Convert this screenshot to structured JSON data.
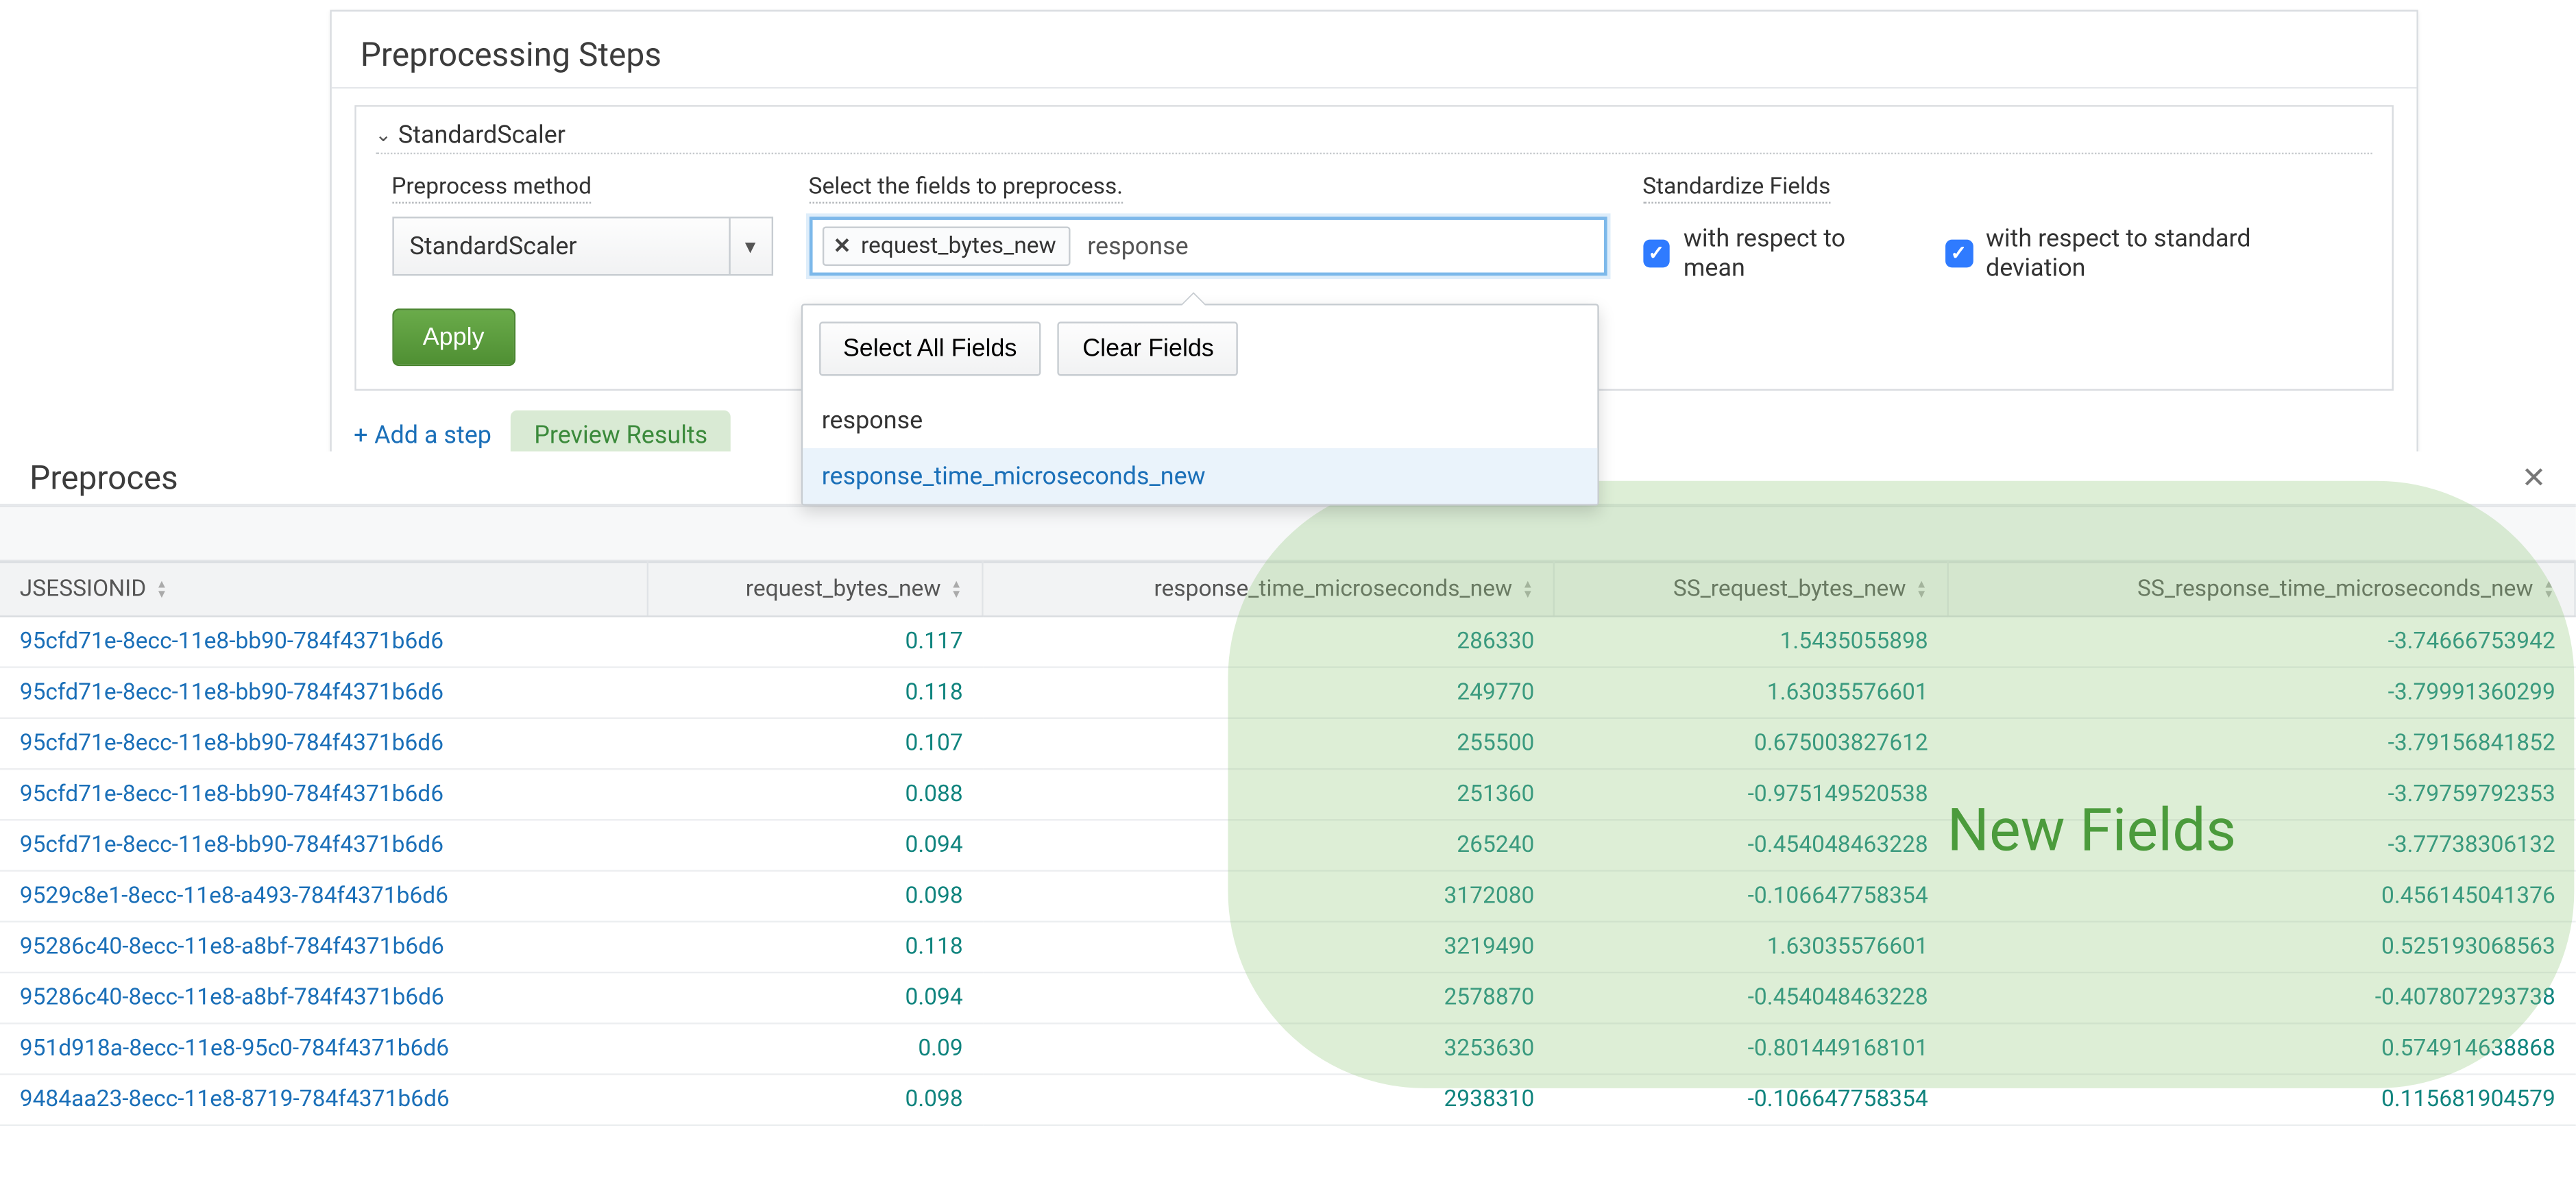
{
  "panel": {
    "title": "Preprocessing Steps",
    "step_name": "StandardScaler",
    "labels": {
      "method": "Preprocess method",
      "fields": "Select the fields to preprocess.",
      "stdfields": "Standardize Fields"
    },
    "method_value": "StandardScaler",
    "token": "request_bytes_new",
    "typed": "response",
    "checks": {
      "mean": "with respect to mean",
      "std": "with respect to standard deviation"
    },
    "apply": "Apply",
    "popover": {
      "select_all": "Select All Fields",
      "clear": "Clear Fields",
      "opt1": "response",
      "opt2": "response_time_microseconds_new"
    },
    "add_step": "Add a step",
    "preview": "Preview Results"
  },
  "preview_title": "Preproces",
  "new_fields_label": "New Fields",
  "columns": {
    "c1": "JSESSIONID",
    "c2": "request_bytes_new",
    "c3": "response_time_microseconds_new",
    "c4": "SS_request_bytes_new",
    "c5": "SS_response_time_microseconds_new"
  },
  "rows": [
    {
      "id": "95cfd71e-8ecc-11e8-bb90-784f4371b6d6",
      "rb": "0.117",
      "rt": "286330",
      "ssrb": "1.5435055898",
      "ssrt": "-3.74666753942"
    },
    {
      "id": "95cfd71e-8ecc-11e8-bb90-784f4371b6d6",
      "rb": "0.118",
      "rt": "249770",
      "ssrb": "1.63035576601",
      "ssrt": "-3.79991360299"
    },
    {
      "id": "95cfd71e-8ecc-11e8-bb90-784f4371b6d6",
      "rb": "0.107",
      "rt": "255500",
      "ssrb": "0.675003827612",
      "ssrt": "-3.79156841852"
    },
    {
      "id": "95cfd71e-8ecc-11e8-bb90-784f4371b6d6",
      "rb": "0.088",
      "rt": "251360",
      "ssrb": "-0.975149520538",
      "ssrt": "-3.79759792353"
    },
    {
      "id": "95cfd71e-8ecc-11e8-bb90-784f4371b6d6",
      "rb": "0.094",
      "rt": "265240",
      "ssrb": "-0.454048463228",
      "ssrt": "-3.77738306132"
    },
    {
      "id": "9529c8e1-8ecc-11e8-a493-784f4371b6d6",
      "rb": "0.098",
      "rt": "3172080",
      "ssrb": "-0.106647758354",
      "ssrt": "0.456145041376"
    },
    {
      "id": "95286c40-8ecc-11e8-a8bf-784f4371b6d6",
      "rb": "0.118",
      "rt": "3219490",
      "ssrb": "1.63035576601",
      "ssrt": "0.525193068563"
    },
    {
      "id": "95286c40-8ecc-11e8-a8bf-784f4371b6d6",
      "rb": "0.094",
      "rt": "2578870",
      "ssrb": "-0.454048463228",
      "ssrt": "-0.407807293738"
    },
    {
      "id": "951d918a-8ecc-11e8-95c0-784f4371b6d6",
      "rb": "0.09",
      "rt": "3253630",
      "ssrb": "-0.801449168101",
      "ssrt": "0.574914638868"
    },
    {
      "id": "9484aa23-8ecc-11e8-8719-784f4371b6d6",
      "rb": "0.098",
      "rt": "2938310",
      "ssrb": "-0.106647758354",
      "ssrt": "0.115681904579"
    }
  ]
}
